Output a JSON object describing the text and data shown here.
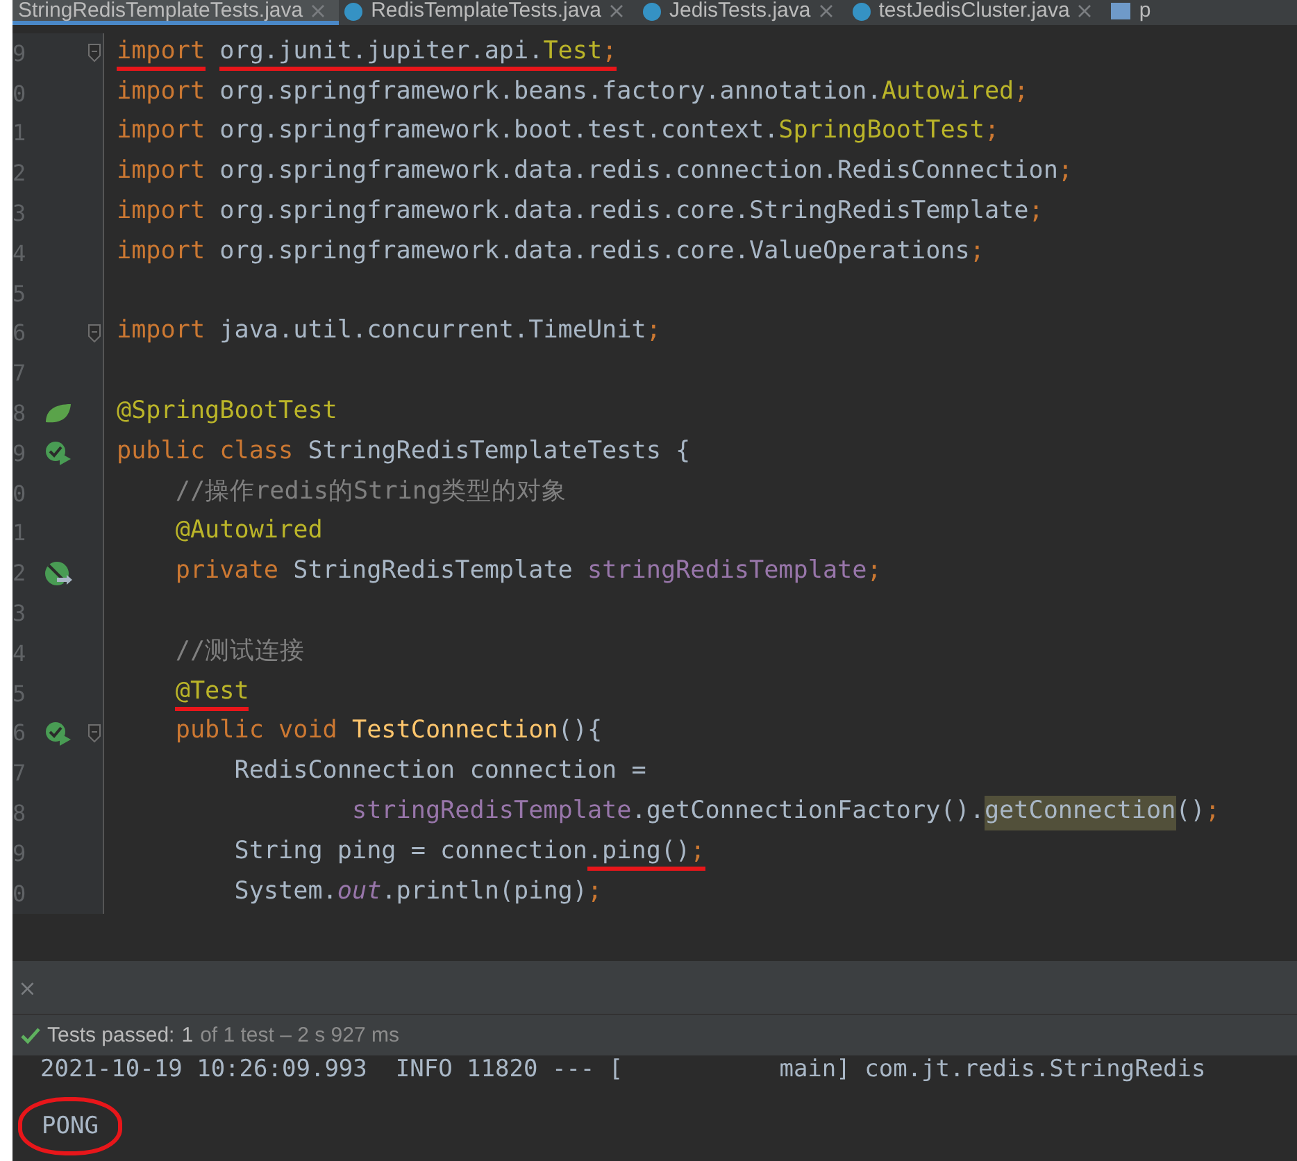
{
  "tabs": [
    {
      "label": "StringRedisTemplateTests.java",
      "selected": true,
      "kind": "plain",
      "closable": true
    },
    {
      "label": "RedisTemplateTests.java",
      "selected": false,
      "kind": "class",
      "closable": true
    },
    {
      "label": "JedisTests.java",
      "selected": false,
      "kind": "class",
      "closable": true
    },
    {
      "label": "testJedisCluster.java",
      "selected": false,
      "kind": "class",
      "closable": true
    },
    {
      "label": "p",
      "selected": false,
      "kind": "maven",
      "closable": false
    }
  ],
  "editor": {
    "lines": [
      {
        "num": "9",
        "kind": "code",
        "fold": true,
        "tokens": [
          {
            "text": "import",
            "kind": "kw",
            "marked": true
          },
          {
            "text": " org.junit.jupiter.api.",
            "kind": "plain",
            "marked": true
          },
          {
            "text": "Test",
            "kind": "ann",
            "marked": true
          },
          {
            "text": ";",
            "kind": "kw",
            "marked": true
          }
        ]
      },
      {
        "num": "0",
        "kind": "code",
        "fold": false,
        "tokens": [
          {
            "text": "import",
            "kind": "kw",
            "marked": false
          },
          {
            "text": " org.springframework.beans.factory.annotation.",
            "kind": "plain",
            "marked": false
          },
          {
            "text": "Autowired",
            "kind": "ann",
            "marked": false
          },
          {
            "text": ";",
            "kind": "kw",
            "marked": false
          }
        ]
      },
      {
        "num": "1",
        "kind": "code",
        "fold": false,
        "tokens": [
          {
            "text": "import",
            "kind": "kw",
            "marked": false
          },
          {
            "text": " org.springframework.boot.test.context.",
            "kind": "plain",
            "marked": false
          },
          {
            "text": "SpringBootTest",
            "kind": "ann",
            "marked": false
          },
          {
            "text": ";",
            "kind": "kw",
            "marked": false
          }
        ]
      },
      {
        "num": "2",
        "kind": "code",
        "fold": false,
        "tokens": [
          {
            "text": "import",
            "kind": "kw",
            "marked": false
          },
          {
            "text": " org.springframework.data.redis.connection.RedisConnection",
            "kind": "plain",
            "marked": false
          },
          {
            "text": ";",
            "kind": "kw",
            "marked": false
          }
        ]
      },
      {
        "num": "3",
        "kind": "code",
        "fold": false,
        "tokens": [
          {
            "text": "import",
            "kind": "kw",
            "marked": false
          },
          {
            "text": " org.springframework.data.redis.core.StringRedisTemplate",
            "kind": "plain",
            "marked": false
          },
          {
            "text": ";",
            "kind": "kw",
            "marked": false
          }
        ]
      },
      {
        "num": "4",
        "kind": "code",
        "fold": false,
        "tokens": [
          {
            "text": "import",
            "kind": "kw",
            "marked": false
          },
          {
            "text": " org.springframework.data.redis.core.ValueOperations",
            "kind": "plain",
            "marked": false
          },
          {
            "text": ";",
            "kind": "kw",
            "marked": false
          }
        ]
      },
      {
        "num": "5",
        "kind": "code",
        "fold": false
      },
      {
        "num": "6",
        "kind": "code",
        "fold": true,
        "tokens": [
          {
            "text": "import",
            "kind": "kw",
            "marked": false
          },
          {
            "text": " java.util.concurrent.TimeUnit",
            "kind": "plain",
            "marked": false
          },
          {
            "text": ";",
            "kind": "kw",
            "marked": false
          }
        ]
      },
      {
        "num": "7",
        "kind": "code",
        "fold": false
      },
      {
        "num": "8",
        "kind": "spring",
        "fold": false,
        "tokens": [
          {
            "text": "@SpringBootTest",
            "kind": "ann",
            "marked": false
          }
        ]
      },
      {
        "num": "9",
        "kind": "test",
        "fold": false,
        "tokens": [
          {
            "text": "public class",
            "kind": "kw",
            "marked": false
          },
          {
            "text": " StringRedisTemplateTests {",
            "kind": "plain",
            "marked": false
          }
        ]
      },
      {
        "num": "0",
        "kind": "code",
        "fold": false,
        "tokens": [
          {
            "text": "    //操作redis的String类型的对象",
            "kind": "comment",
            "marked": false
          }
        ]
      },
      {
        "num": "1",
        "kind": "code",
        "fold": false,
        "tokens": [
          {
            "text": "    @Autowired",
            "kind": "ann",
            "marked": false
          }
        ]
      },
      {
        "num": "2",
        "kind": "bean",
        "fold": false,
        "tokens": [
          {
            "text": "    private",
            "kind": "kw",
            "marked": false
          },
          {
            "text": " StringRedisTemplate ",
            "kind": "plain",
            "marked": false
          },
          {
            "text": "stringRedisTemplate",
            "kind": "field",
            "marked": false
          },
          {
            "text": ";",
            "kind": "kw",
            "marked": false
          }
        ]
      },
      {
        "num": "3",
        "kind": "code",
        "fold": false
      },
      {
        "num": "4",
        "kind": "code",
        "fold": false,
        "tokens": [
          {
            "text": "    //测试连接",
            "kind": "comment",
            "marked": false
          }
        ]
      },
      {
        "num": "5",
        "kind": "code",
        "fold": false,
        "tokens": [
          {
            "text": "    @Test",
            "kind": "ann",
            "marked": true
          }
        ]
      },
      {
        "num": "6",
        "kind": "test",
        "fold": true,
        "tokens": [
          {
            "text": "    public void",
            "kind": "kw",
            "marked": false
          },
          {
            "text": " TestConnection",
            "kind": "method",
            "marked": false
          },
          {
            "text": "(){",
            "kind": "plain",
            "marked": false
          }
        ]
      },
      {
        "num": "7",
        "kind": "code",
        "fold": false,
        "tokens": [
          {
            "text": "        RedisConnection connection =",
            "kind": "plain",
            "marked": false
          }
        ]
      },
      {
        "num": "8",
        "kind": "code",
        "fold": false,
        "tokens": [
          {
            "text": "                stringRedisTemplate",
            "kind": "field",
            "marked": false
          },
          {
            "text": ".getConnectionFactory().",
            "kind": "plain",
            "marked": false
          },
          {
            "text": "getConnection",
            "kind": "hl",
            "marked": false
          },
          {
            "text": "()",
            "kind": "plain",
            "marked": false
          },
          {
            "text": ";",
            "kind": "kw",
            "marked": false
          }
        ]
      },
      {
        "num": "9",
        "kind": "code",
        "fold": false,
        "tokens": [
          {
            "text": "        String ping = connection",
            "kind": "plain",
            "marked": false
          },
          {
            "text": ".ping()",
            "kind": "plain",
            "marked": true
          },
          {
            "text": ";",
            "kind": "kw",
            "marked": true
          }
        ]
      },
      {
        "num": "0",
        "kind": "code",
        "fold": false,
        "tokens": [
          {
            "text": "        System.",
            "kind": "plain",
            "marked": false
          },
          {
            "text": "out",
            "kind": "static",
            "marked": false
          },
          {
            "text": ".println(ping)",
            "kind": "plain",
            "marked": false
          },
          {
            "text": ";",
            "kind": "kw",
            "marked": false
          }
        ]
      }
    ]
  },
  "run_panel": {
    "close": "×",
    "status": {
      "label": "Tests passed:",
      "count": "1",
      "detail": "of 1 test – 2 s 927 ms"
    },
    "console": [
      {
        "text": "2021-10-19 10:26:09.993  INFO 11820 --- [           main] com.jt.redis.StringRedis",
        "circled": false
      },
      {
        "text": "PONG",
        "circled": true
      }
    ]
  }
}
